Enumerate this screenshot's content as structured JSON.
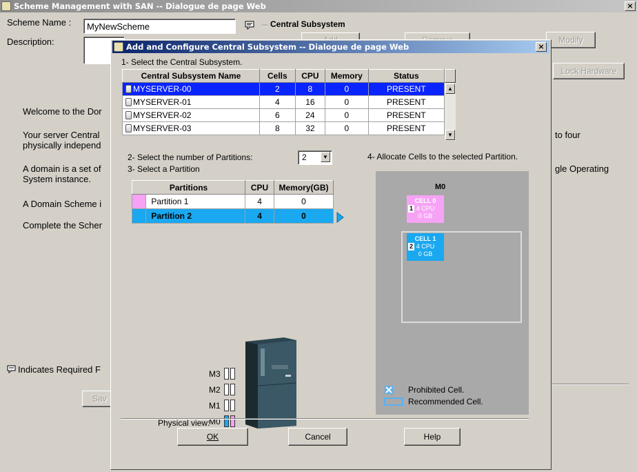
{
  "parent": {
    "title": "Scheme Management with SAN -- Dialogue de page Web",
    "close_label": "×",
    "scheme_name_label": "Scheme Name :",
    "scheme_name_value": "MyNewScheme",
    "description_label": "Description:",
    "central_subsystem_label": "Central Subsystem",
    "add_label": "Add",
    "remove_label": "Remove",
    "modify_label": "Modify",
    "lock_hardware_label": "Lock Hardware",
    "welcome_text": "Welcome to the Dor",
    "server_text_1": "Your server Central",
    "server_text_2": "physically independ",
    "server_tail": "to four",
    "domain_text_1": "A domain is a set of",
    "domain_text_2": "System instance.",
    "domain_tail": "gle Operating",
    "scheme_text": "A Domain Scheme i",
    "complete_text": "Complete the Scher",
    "required_text": "Indicates Required F",
    "save_label": "Sav"
  },
  "dialog": {
    "title": "Add and Configure Central Subsystem -- Dialogue de page Web",
    "close_label": "×",
    "step1": "1- Select the Central Subsystem.",
    "step2": "2- Select the number of Partitions:",
    "step3": "3- Select a Partition",
    "step4": "4- Allocate Cells to the selected Partition.",
    "partitions_count": "2",
    "subsystem_table": {
      "headers": [
        "Central Subsystem Name",
        "Cells",
        "CPU",
        "Memory",
        "Status"
      ],
      "rows": [
        {
          "name": "MYSERVER-00",
          "cells": "2",
          "cpu": "8",
          "memory": "0",
          "status": "PRESENT"
        },
        {
          "name": "MYSERVER-01",
          "cells": "4",
          "cpu": "16",
          "memory": "0",
          "status": "PRESENT"
        },
        {
          "name": "MYSERVER-02",
          "cells": "6",
          "cpu": "24",
          "memory": "0",
          "status": "PRESENT"
        },
        {
          "name": "MYSERVER-03",
          "cells": "8",
          "cpu": "32",
          "memory": "0",
          "status": "PRESENT"
        }
      ]
    },
    "partition_table": {
      "headers": [
        "Partitions",
        "CPU",
        "Memory(GB)"
      ],
      "rows": [
        {
          "name": "Partition 1",
          "cpu": "4",
          "memory": "0"
        },
        {
          "name": "Partition 2",
          "cpu": "4",
          "memory": "0"
        }
      ]
    },
    "module_label": "M0",
    "cells": [
      {
        "num": "1",
        "name": "CELL 0",
        "cpu": "4 CPU",
        "mem": "0 GB"
      },
      {
        "num": "2",
        "name": "CELL 1",
        "cpu": "4 CPU",
        "mem": "0 GB"
      }
    ],
    "physical_view_label": "Physical view:",
    "modules": [
      "M3",
      "M2",
      "M1",
      "M0"
    ],
    "legend_prohibited": "Prohibited Cell.",
    "legend_recommended": "Recommended Cell.",
    "ok_label": "OK",
    "cancel_label": "Cancel",
    "help_label": "Help",
    "colors": {
      "partition1": "#f6a3f6",
      "partition2": "#1aa8f0",
      "selection": "#0a24ff"
    }
  }
}
